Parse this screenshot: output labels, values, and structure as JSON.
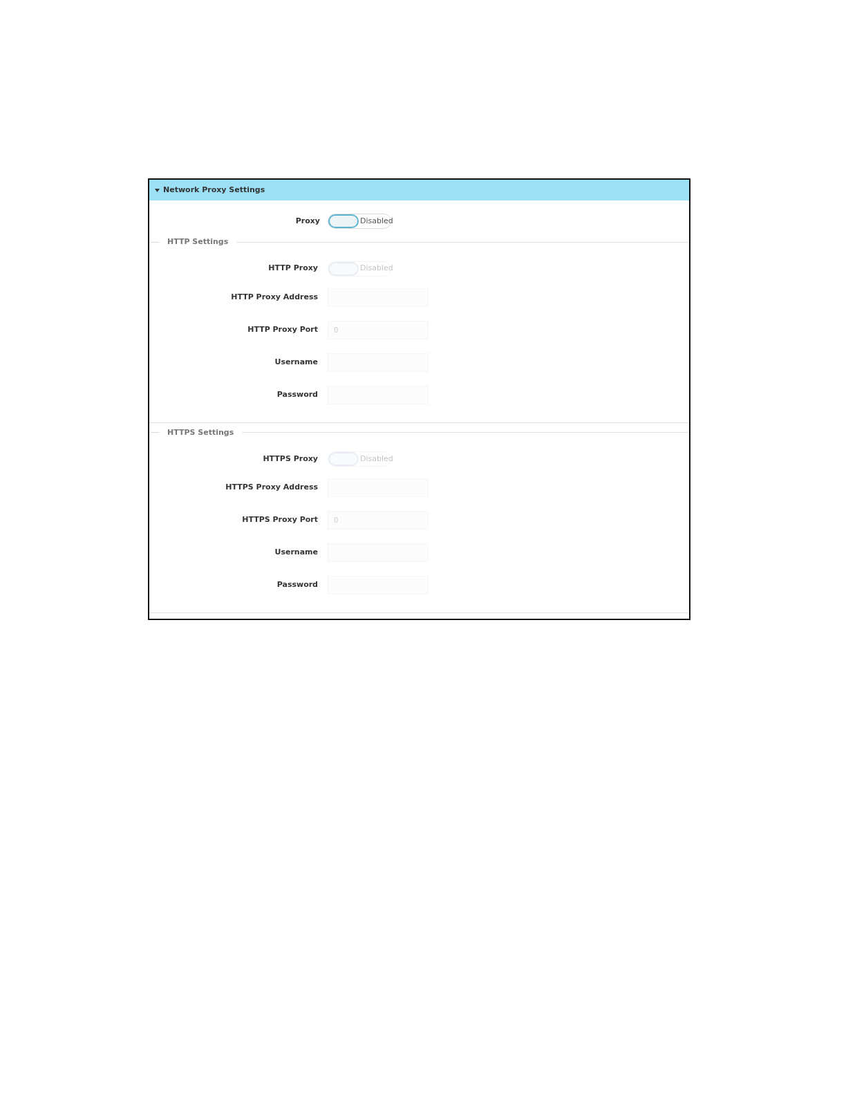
{
  "panel": {
    "title": "Network Proxy Settings",
    "expanded": true
  },
  "proxy": {
    "label": "Proxy",
    "on": false,
    "disabled": false,
    "state_text": "Disabled"
  },
  "sections": [
    {
      "title": "HTTP Settings",
      "rows": [
        {
          "kind": "toggle",
          "label": "HTTP Proxy",
          "on": false,
          "disabled": true,
          "state_text": "Disabled"
        },
        {
          "kind": "field",
          "label": "HTTP Proxy Address",
          "disabled": true
        },
        {
          "kind": "field",
          "label": "HTTP Proxy Port",
          "value": "0",
          "disabled": true
        },
        {
          "kind": "field",
          "label": "Username",
          "disabled": true
        },
        {
          "kind": "field",
          "label": "Password",
          "disabled": true
        }
      ]
    },
    {
      "title": "HTTPS Settings",
      "rows": [
        {
          "kind": "toggle",
          "label": "HTTPS Proxy",
          "on": false,
          "disabled": true,
          "state_text": "Disabled"
        },
        {
          "kind": "field",
          "label": "HTTPS Proxy Address",
          "disabled": true
        },
        {
          "kind": "field",
          "label": "HTTPS Proxy Port",
          "value": "0",
          "disabled": true
        },
        {
          "kind": "field",
          "label": "Username",
          "disabled": true
        },
        {
          "kind": "field",
          "label": "Password",
          "disabled": true
        }
      ]
    }
  ]
}
